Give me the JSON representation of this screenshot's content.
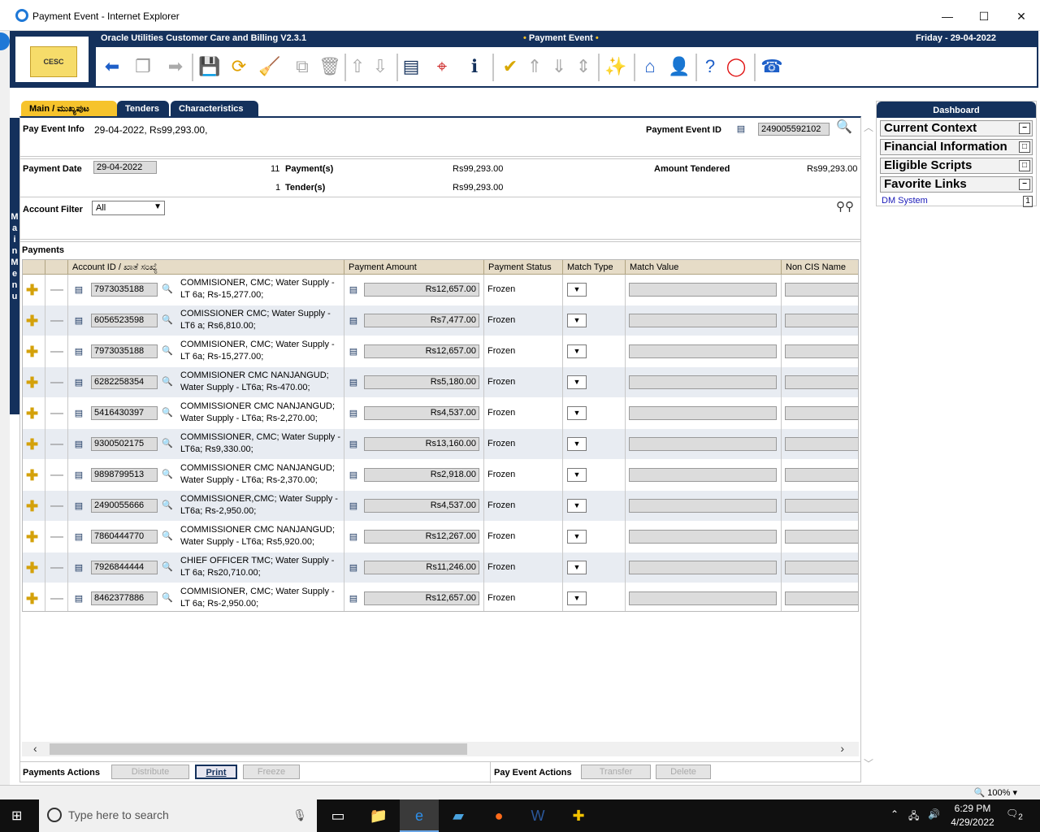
{
  "window": {
    "title": "Payment Event - Internet Explorer",
    "minimize": "—",
    "maximize": "☐",
    "close": "✕"
  },
  "header": {
    "app_name": "Oracle Utilities Customer Care and Billing V2.3.1",
    "page_name": "Payment Event",
    "date": "Friday - 29-04-2022",
    "logo_text": "CESC"
  },
  "side_menu": [
    "M",
    "a",
    "i",
    "n",
    " ",
    "M",
    "e",
    "n",
    "u"
  ],
  "tabs": [
    {
      "label": "Main / ಮುಖ್ಯಪುಟ",
      "active": true
    },
    {
      "label": "Tenders",
      "active": false
    },
    {
      "label": "Characteristics",
      "active": false
    }
  ],
  "pay_event_info": {
    "label": "Pay Event Info",
    "value": "29-04-2022, Rs99,293.00,",
    "id_label": "Payment Event ID",
    "id_value": "249005592102"
  },
  "summary": {
    "payment_date_label": "Payment Date",
    "payment_date": "29-04-2022",
    "payments_count": "11",
    "payments_label": "Payment(s)",
    "payments_amount": "Rs99,293.00",
    "tenders_count": "1",
    "tenders_label": "Tender(s)",
    "tenders_amount": "Rs99,293.00",
    "amount_tendered_label": "Amount Tendered",
    "amount_tendered": "Rs99,293.00"
  },
  "account_filter": {
    "label": "Account Filter",
    "value": "All"
  },
  "payments": {
    "section_label": "Payments",
    "columns": [
      "Account ID / ಖಾತೆ ಸಂಖ್ಯೆ",
      "Payment Amount",
      "Payment Status",
      "Match Type",
      "Match Value",
      "Non CIS Name"
    ],
    "rows": [
      {
        "account_id": "7973035188",
        "desc": "COMMISIONER, CMC; Water Supply - LT 6a; Rs-15,277.00;",
        "amount": "Rs12,657.00",
        "status": "Frozen"
      },
      {
        "account_id": "6056523598",
        "desc": "COMISSIONER CMC; Water Supply - LT6 a; Rs6,810.00;",
        "amount": "Rs7,477.00",
        "status": "Frozen"
      },
      {
        "account_id": "7973035188",
        "desc": "COMMISIONER, CMC; Water Supply - LT 6a; Rs-15,277.00;",
        "amount": "Rs12,657.00",
        "status": "Frozen"
      },
      {
        "account_id": "6282258354",
        "desc": "COMMISIONER CMC NANJANGUD; Water Supply - LT6a; Rs-470.00;",
        "amount": "Rs5,180.00",
        "status": "Frozen"
      },
      {
        "account_id": "5416430397",
        "desc": "COMMISSIONER CMC NANJANGUD; Water Supply - LT6a; Rs-2,270.00;",
        "amount": "Rs4,537.00",
        "status": "Frozen"
      },
      {
        "account_id": "9300502175",
        "desc": "COMMISSIONER, CMC; Water Supply - LT6a; Rs9,330.00;",
        "amount": "Rs13,160.00",
        "status": "Frozen"
      },
      {
        "account_id": "9898799513",
        "desc": "COMMISSIONER CMC NANJANGUD; Water Supply - LT6a; Rs-2,370.00;",
        "amount": "Rs2,918.00",
        "status": "Frozen"
      },
      {
        "account_id": "2490055666",
        "desc": "COMMISSIONER,CMC; Water Supply - LT6a; Rs-2,950.00;",
        "amount": "Rs4,537.00",
        "status": "Frozen"
      },
      {
        "account_id": "7860444770",
        "desc": "COMMISSIONER CMC NANJANGUD; Water Supply - LT6a; Rs5,920.00;",
        "amount": "Rs12,267.00",
        "status": "Frozen"
      },
      {
        "account_id": "7926844444",
        "desc": "CHIEF OFFICER TMC; Water Supply - LT 6a; Rs20,710.00;",
        "amount": "Rs11,246.00",
        "status": "Frozen"
      },
      {
        "account_id": "8462377886",
        "desc": "COMMISIONER, CMC; Water Supply - LT 6a; Rs-2,950.00;",
        "amount": "Rs12,657.00",
        "status": "Frozen"
      }
    ]
  },
  "actions": {
    "payments_label": "Payments Actions",
    "distribute": "Distribute",
    "print": "Print",
    "freeze": "Freeze",
    "pay_event_label": "Pay Event Actions",
    "transfer": "Transfer",
    "delete": "Delete"
  },
  "dashboard": {
    "title": "Dashboard",
    "sections": [
      "Current Context",
      "Financial Information",
      "Eligible Scripts",
      "Favorite Links"
    ],
    "link": "DM System",
    "link_badge": "1"
  },
  "statusbar": {
    "zoom": "100%"
  },
  "taskbar": {
    "search_placeholder": "Type here to search",
    "time": "6:29 PM",
    "date": "4/29/2022",
    "notif_count": "2"
  },
  "colors": {
    "brand_navy": "#14315c",
    "accent_gold": "#f6c32c"
  }
}
